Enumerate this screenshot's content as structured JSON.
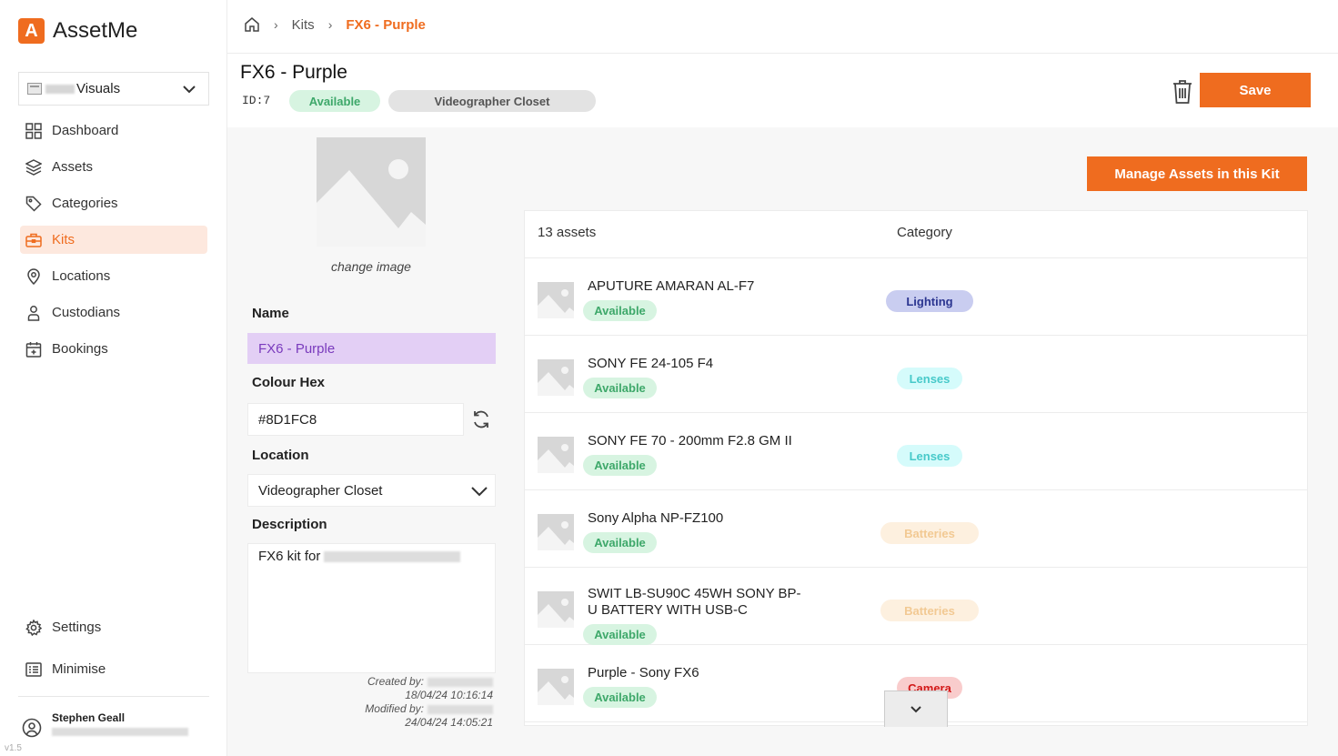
{
  "brand": {
    "logo_letter": "A",
    "name": "AssetMe",
    "accent": "#ef6c1f"
  },
  "workspace": {
    "name": "Visuals"
  },
  "nav": [
    {
      "label": "Dashboard",
      "icon": "grid-icon"
    },
    {
      "label": "Assets",
      "icon": "layers-icon"
    },
    {
      "label": "Categories",
      "icon": "tag-icon"
    },
    {
      "label": "Kits",
      "icon": "briefcase-icon",
      "active": true
    },
    {
      "label": "Locations",
      "icon": "map-pin-icon"
    },
    {
      "label": "Custodians",
      "icon": "person-icon"
    },
    {
      "label": "Bookings",
      "icon": "calendar-icon"
    }
  ],
  "nav_bottom": {
    "settings": "Settings",
    "minimise": "Minimise"
  },
  "user": {
    "name": "Stephen Geall"
  },
  "version": "v1.5",
  "breadcrumb": {
    "kits": "Kits",
    "current": "FX6 - Purple"
  },
  "header": {
    "title": "FX6 - Purple",
    "id": "ID:7",
    "status": "Available",
    "location": "Videographer Closet",
    "save_label": "Save"
  },
  "form": {
    "change_image": "change image",
    "name_label": "Name",
    "name_value": "FX6 - Purple",
    "hex_label": "Colour Hex",
    "hex_value": "#8D1FC8",
    "location_label": "Location",
    "location_value": "Videographer Closet",
    "description_label": "Description",
    "description_value": "FX6 kit for",
    "created_label": "Created by:",
    "created_date": "18/04/24 10:16:14",
    "modified_label": "Modified by:",
    "modified_date": "24/04/24 14:05:21"
  },
  "panel": {
    "manage_label": "Manage Assets in this Kit",
    "count_header": "13 assets",
    "category_header": "Category"
  },
  "assets": [
    {
      "name": "APUTURE AMARAN AL-F7",
      "status": "Available",
      "category": "Lighting",
      "bg": "#c9cdf0",
      "fg": "#2b3590"
    },
    {
      "name": "SONY FE 24-105 F4",
      "status": "Available",
      "category": "Lenses",
      "bg": "#d5fbfb",
      "fg": "#47c9c9"
    },
    {
      "name": "SONY FE 70 - 200mm F2.8 GM II",
      "status": "Available",
      "category": "Lenses",
      "bg": "#d5fbfb",
      "fg": "#47c9c9"
    },
    {
      "name": "Sony Alpha NP-FZ100",
      "status": "Available",
      "category": "Batteries",
      "bg": "#fdf0df",
      "fg": "#f2c993"
    },
    {
      "name": "SWIT LB-SU90C 45WH SONY BP-U BATTERY WITH USB-C",
      "status": "Available",
      "category": "Batteries",
      "bg": "#fdf0df",
      "fg": "#f2c993"
    },
    {
      "name": "Purple - Sony FX6",
      "status": "Available",
      "category": "Camera",
      "bg": "#f9cccc",
      "fg": "#d21818"
    }
  ]
}
